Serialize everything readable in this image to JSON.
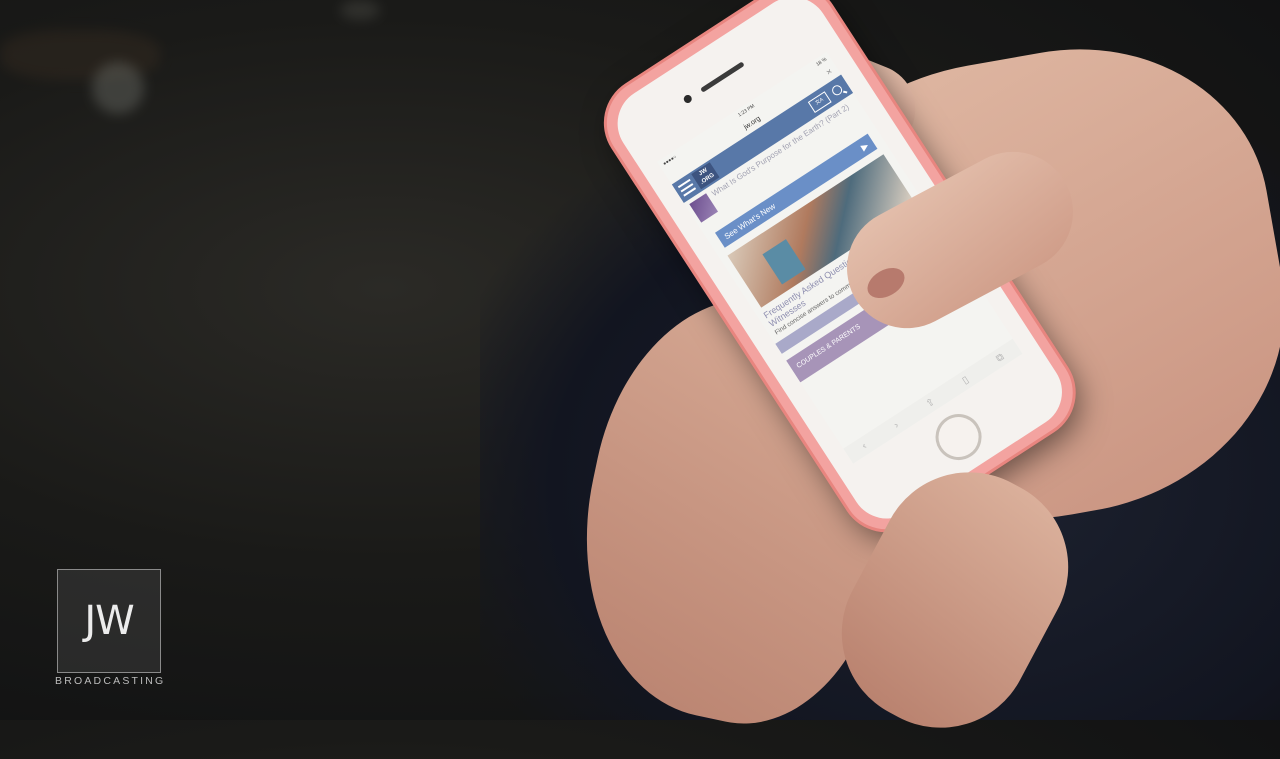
{
  "phone": {
    "status_time": "1:23 PM",
    "status_battery": "18 %",
    "url": "jw.org",
    "close_glyph": "×",
    "logo": "JW.ORG",
    "logo_line1": "JW",
    "logo_line2": ".ORG",
    "language_icon": "language-icon",
    "article1_title": "What Is God's Purpose for the Earth? (Part 2)",
    "button_label": "See What's New",
    "faq_title": "Frequently Asked Questions About Jehovah's Witnesses",
    "faq_desc": "Find concise answers to common questions people ask.",
    "category_label": "COUPLES & PARENTS"
  },
  "watermark": {
    "logo": "JW",
    "label": "BROADCASTING"
  },
  "colors": {
    "phone_case": "#f3a3a0",
    "site_nav": "#5878a8",
    "button": "#6a8fc7"
  }
}
